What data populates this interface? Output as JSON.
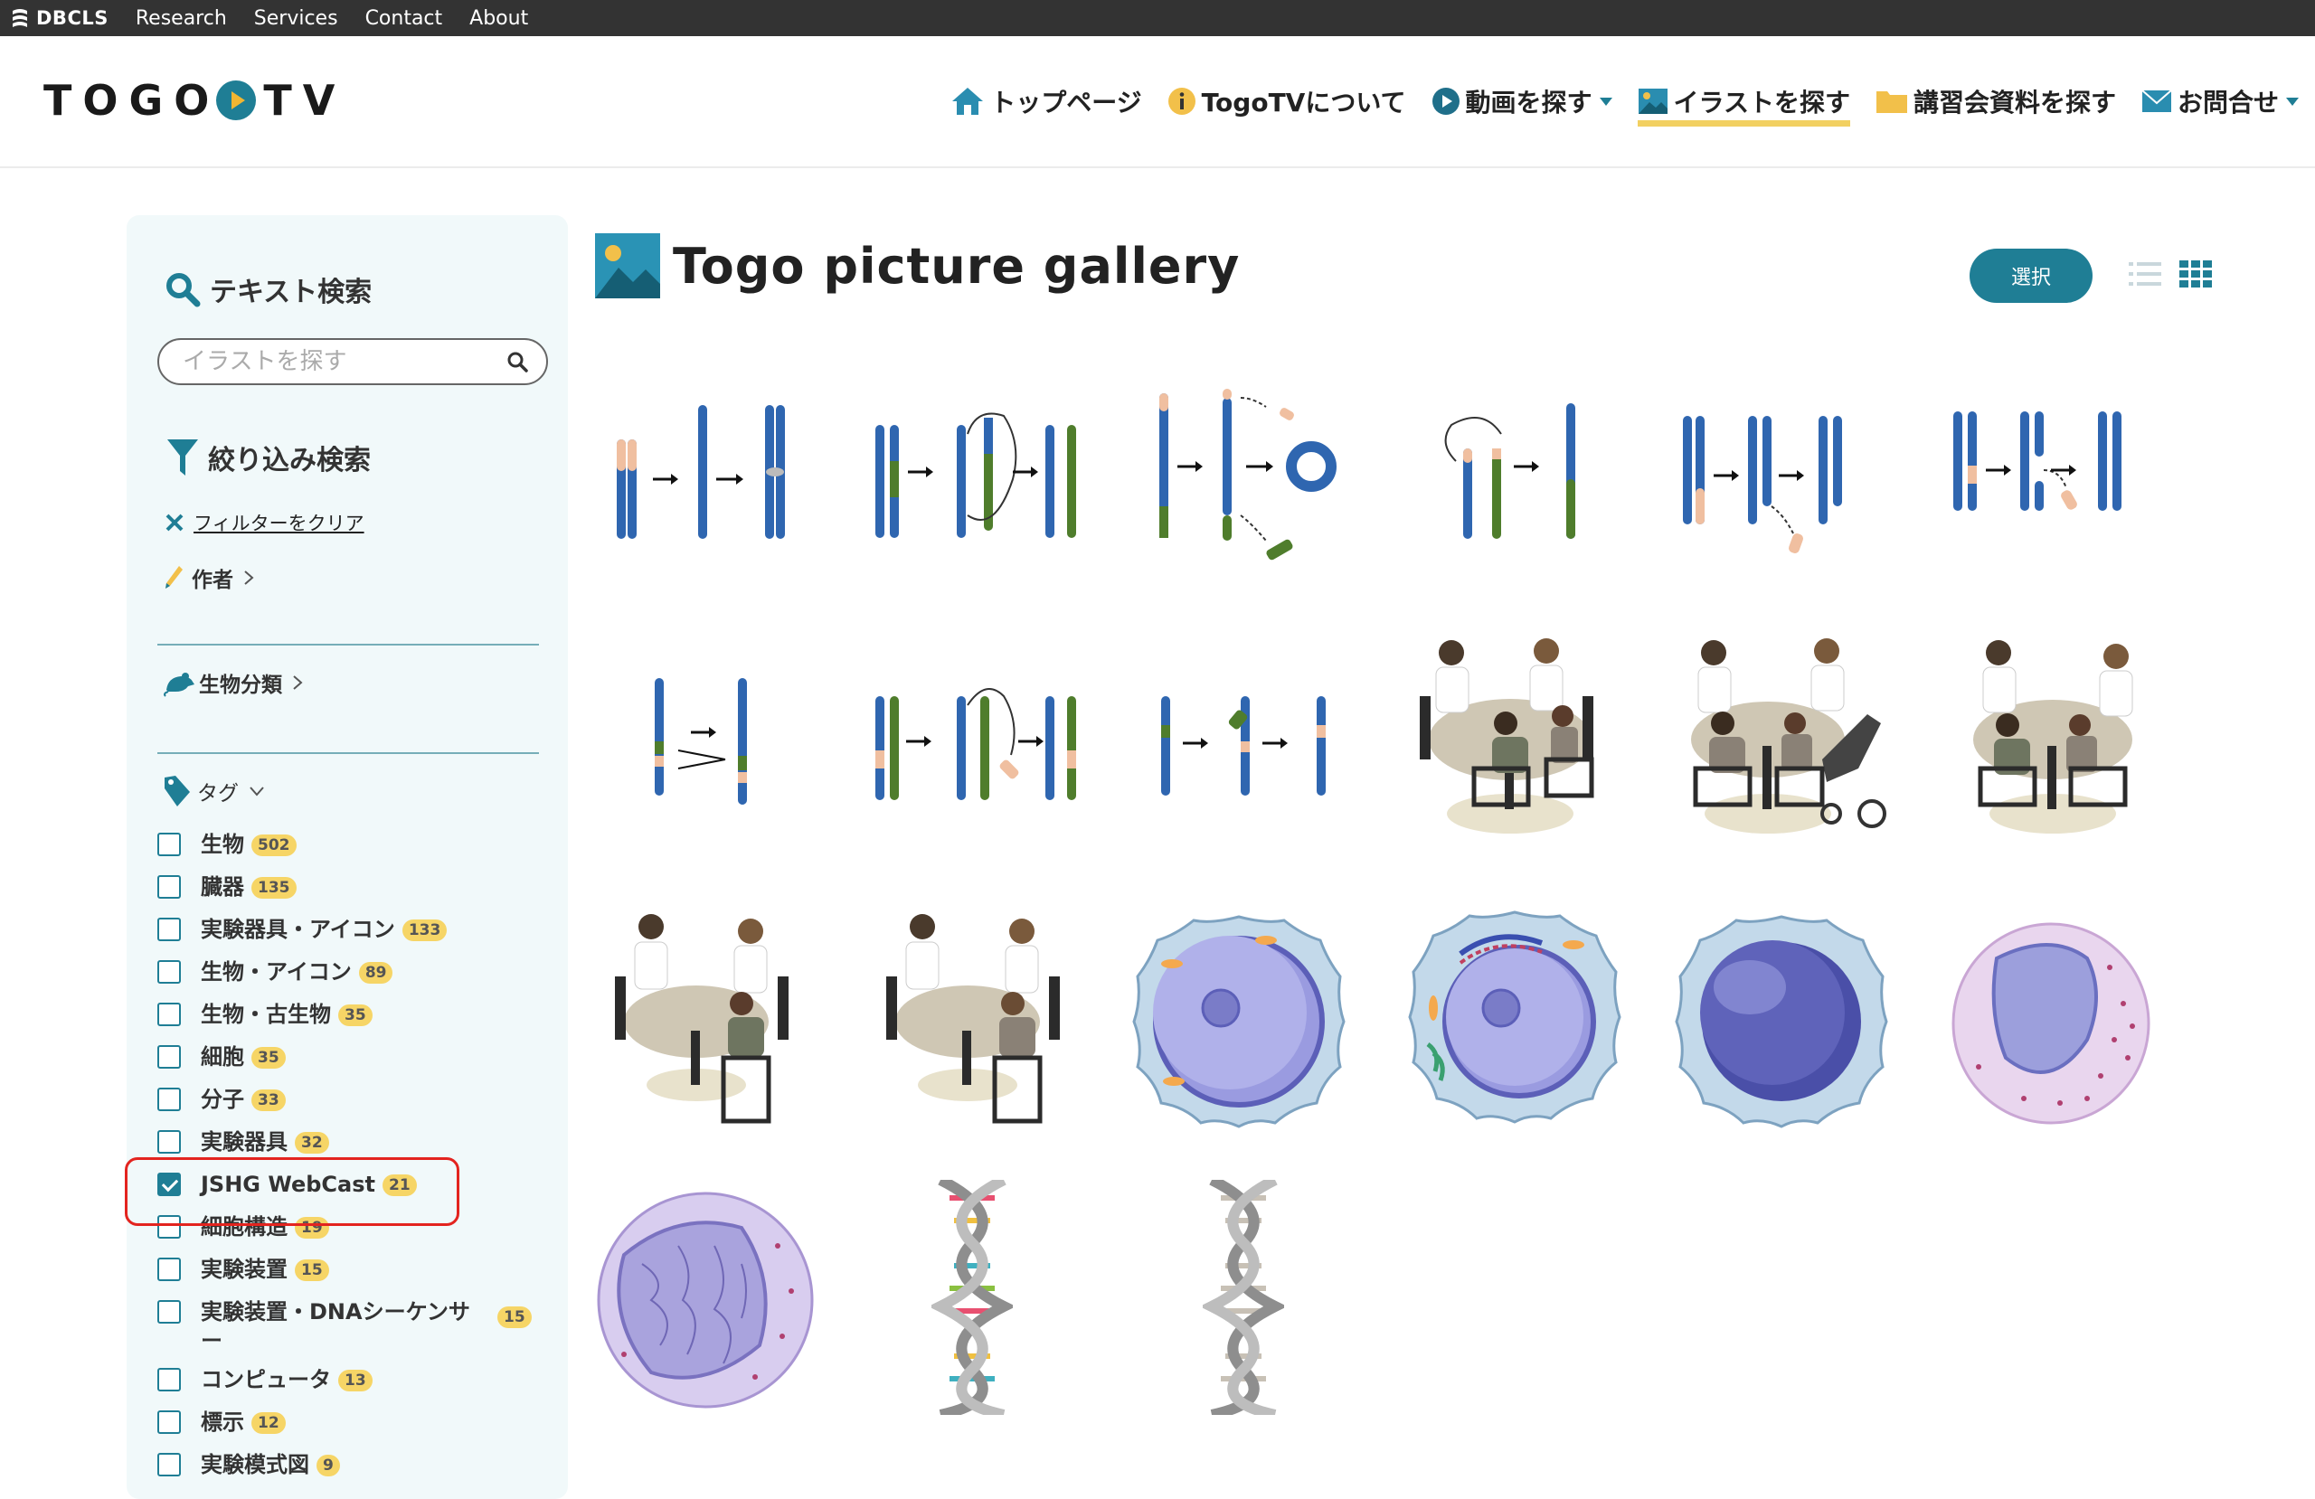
{
  "topbar": {
    "brand": "DBCLS",
    "links": [
      "Research",
      "Services",
      "Contact",
      "About"
    ]
  },
  "header": {
    "logo_left": "TOGO",
    "logo_right": "TV",
    "nav": [
      {
        "label": "トップページ",
        "icon": "home-icon"
      },
      {
        "label": "TogoTVについて",
        "icon": "info-icon"
      },
      {
        "label": "動画を探す",
        "icon": "play-icon"
      },
      {
        "label": "イラストを探す",
        "icon": "picture-icon"
      },
      {
        "label": "講習会資料を探す",
        "icon": "folder-icon"
      },
      {
        "label": "お問合せ",
        "icon": "mail-icon"
      }
    ]
  },
  "sidebar": {
    "text_search_title": "テキスト検索",
    "search_placeholder": "イラストを探す",
    "filter_title": "絞り込み検索",
    "clear_filter": "フィルターをクリア",
    "author_label": "作者",
    "organism_label": "生物分類",
    "tag_label": "タグ",
    "tags": [
      {
        "label": "生物",
        "count": "502",
        "checked": false
      },
      {
        "label": "臓器",
        "count": "135",
        "checked": false
      },
      {
        "label": "実験器具・アイコン",
        "count": "133",
        "checked": false
      },
      {
        "label": "生物・アイコン",
        "count": "89",
        "checked": false
      },
      {
        "label": "生物・古生物",
        "count": "35",
        "checked": false
      },
      {
        "label": "細胞",
        "count": "35",
        "checked": false
      },
      {
        "label": "分子",
        "count": "33",
        "checked": false
      },
      {
        "label": "実験器具",
        "count": "32",
        "checked": false
      },
      {
        "label": "JSHG WebCast",
        "count": "21",
        "checked": true
      },
      {
        "label": "細胞構造",
        "count": "19",
        "checked": false
      },
      {
        "label": "実験装置",
        "count": "15",
        "checked": false
      },
      {
        "label": "実験装置・DNAシーケンサー",
        "count": "15",
        "checked": false
      },
      {
        "label": "コンピュータ",
        "count": "13",
        "checked": false
      },
      {
        "label": "標示",
        "count": "12",
        "checked": false
      },
      {
        "label": "実験模式図",
        "count": "9",
        "checked": false
      }
    ]
  },
  "gallery": {
    "title": "Togo picture gallery",
    "select_button": "選択",
    "items": [
      {
        "kind": "chromosome-diagram"
      },
      {
        "kind": "chromosome-diagram"
      },
      {
        "kind": "chromosome-diagram"
      },
      {
        "kind": "chromosome-diagram"
      },
      {
        "kind": "chromosome-diagram"
      },
      {
        "kind": "chromosome-diagram"
      },
      {
        "kind": "chromosome-diagram"
      },
      {
        "kind": "chromosome-diagram"
      },
      {
        "kind": "chromosome-diagram"
      },
      {
        "kind": "meeting-illustration"
      },
      {
        "kind": "meeting-illustration"
      },
      {
        "kind": "meeting-illustration"
      },
      {
        "kind": "meeting-illustration"
      },
      {
        "kind": "meeting-illustration"
      },
      {
        "kind": "cell-illustration"
      },
      {
        "kind": "cell-illustration"
      },
      {
        "kind": "cell-illustration"
      },
      {
        "kind": "cell-illustration"
      },
      {
        "kind": "cell-illustration"
      },
      {
        "kind": "dna-helix"
      },
      {
        "kind": "dna-helix"
      }
    ]
  },
  "colors": {
    "accent": "#1f7e95",
    "badge": "#f6d566",
    "chromosome_blue": "#2f66b0",
    "chromosome_green": "#4f7d2c",
    "highlight_red": "#e3241f"
  }
}
